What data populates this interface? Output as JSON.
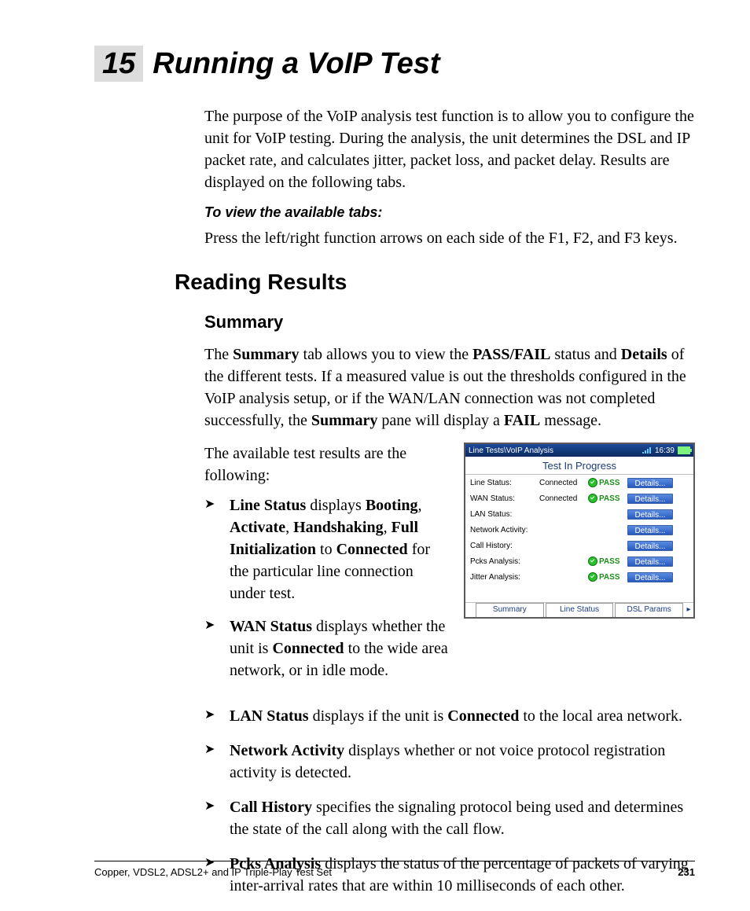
{
  "chapter": {
    "number": "15",
    "title": "Running a VoIP Test"
  },
  "intro": "The purpose of the VoIP analysis test function is to allow you to configure the unit for VoIP testing. During the analysis, the unit determines the DSL and IP packet rate, and calculates jitter, packet loss, and packet delay. Results are displayed on the following tabs.",
  "instr_heading": "To view the available tabs:",
  "instr_body": "Press the left/right function arrows on each side of the F1, F2, and F3 keys.",
  "h2": "Reading Results",
  "h3": "Summary",
  "summary_para": {
    "pre1": "The ",
    "b1": "Summary",
    "mid1": " tab allows you to view the ",
    "b2": "PASS/FAIL",
    "mid2": " status and ",
    "b3": "Details",
    "mid3": " of the different tests. If a measured value is out the thresholds configured in the VoIP analysis setup, or if the WAN/LAN connection was not completed successfully, the ",
    "b4": "Summary",
    "mid4": " pane will display a ",
    "b5": "FAIL",
    "post": " message."
  },
  "avail_intro": "The available test results are the following:",
  "bullets_narrow": [
    {
      "lead": "Line Status",
      "t1": " displays ",
      "b1": "Booting",
      "t2": ", ",
      "b2": "Activate",
      "t3": ", ",
      "b3": "Handshaking",
      "t4": ", ",
      "b4": "Full Initialization",
      "t5": " to ",
      "b5": "Connected",
      "tail": " for the particular line connection under test."
    },
    {
      "lead": "WAN Status",
      "t1": " displays whether the unit is ",
      "b1": "Connected",
      "tail": " to the wide area network, or in idle mode."
    }
  ],
  "bullets_full": [
    {
      "lead": "LAN Status",
      "t1": " displays if the unit is ",
      "b1": "Connected",
      "tail": " to the local area network."
    },
    {
      "lead": "Network Activity",
      "tail": " displays whether or not voice protocol registration activity is detected."
    },
    {
      "lead": "Call History",
      "tail": " specifies the signaling protocol being used and determines the state of the call along with the call flow."
    },
    {
      "lead": "Pcks Analysis",
      "tail": " displays the status of the percentage of packets of varying inter-arrival rates that are within 10 milliseconds of each other."
    }
  ],
  "shot": {
    "crumb": "Line Tests\\VoIP Analysis",
    "clock": "16:39",
    "header": "Test In Progress",
    "details_label": "Details...",
    "pass_label": "PASS",
    "rows": [
      {
        "label": "Line Status:",
        "value": "Connected",
        "pass": true
      },
      {
        "label": "WAN Status:",
        "value": "Connected",
        "pass": true
      },
      {
        "label": "LAN Status:",
        "value": "",
        "pass": false
      },
      {
        "label": "Network Activity:",
        "value": "",
        "pass": false
      },
      {
        "label": "Call History:",
        "value": "",
        "pass": false
      },
      {
        "label": "Pcks Analysis:",
        "value": "",
        "pass": true
      },
      {
        "label": "Jitter Analysis:",
        "value": "",
        "pass": true
      }
    ],
    "tabs": [
      "Summary",
      "Line Status",
      "DSL Params"
    ]
  },
  "footer": {
    "left": "Copper, VDSL2, ADSL2+ and IP Triple-Play Test Set",
    "page": "231"
  }
}
